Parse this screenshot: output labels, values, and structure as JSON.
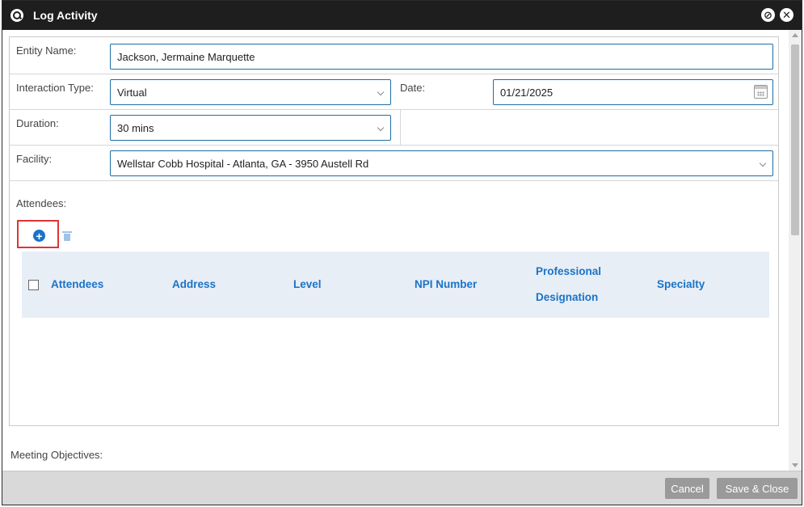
{
  "window": {
    "title": "Log Activity"
  },
  "form": {
    "entity_name": {
      "label": "Entity Name:",
      "value": "Jackson, Jermaine Marquette"
    },
    "interaction_type": {
      "label": "Interaction Type:",
      "value": "Virtual"
    },
    "date": {
      "label": "Date:",
      "value": "01/21/2025"
    },
    "duration": {
      "label": "Duration:",
      "value": "30 mins"
    },
    "facility": {
      "label": "Facility:",
      "value": "Wellstar Cobb Hospital - Atlanta, GA - 3950 Austell Rd"
    },
    "attendees_label": "Attendees:",
    "meeting_objectives_label": "Meeting Objectives:"
  },
  "attendees_grid": {
    "columns": {
      "attendees": "Attendees",
      "address": "Address",
      "level": "Level",
      "npi": "NPI Number",
      "designation_line1": "Professional",
      "designation_line2": "Designation",
      "specialty": "Specialty"
    }
  },
  "footer": {
    "cancel": "Cancel",
    "save_close": "Save & Close"
  },
  "icons": {
    "app": "search-icon",
    "minimize": "minimize-icon",
    "close": "close-icon",
    "add": "add-circle-icon",
    "delete": "trash-icon",
    "calendar": "calendar-icon"
  },
  "colors": {
    "titlebar": "#1e1e1e",
    "accent": "#1a73c7",
    "highlight": "#e03434",
    "button": "#9a9a9a"
  }
}
